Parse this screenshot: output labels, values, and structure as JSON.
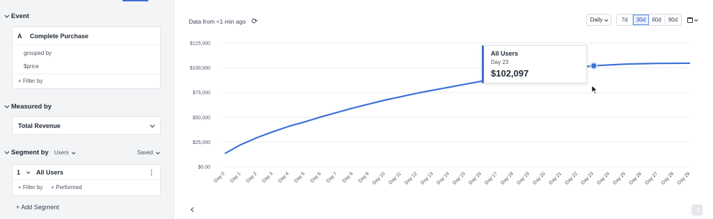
{
  "sidebar": {
    "event": {
      "section_label": "Event",
      "letter": "A",
      "name": "Complete Purchase",
      "grouped_by_label": "grouped by",
      "group_property": "$price",
      "filter_label": "+ Filter by"
    },
    "measured_by": {
      "section_label": "Measured by",
      "value": "Total Revenue"
    },
    "segment": {
      "section_label": "Segment by",
      "type_value": "Users",
      "saved_label": "Saved",
      "number": "1",
      "name": "All Users",
      "filter_label": "+ Filter by",
      "performed_label": "+ Performed",
      "add_label": "+ Add Segment"
    }
  },
  "toolbar": {
    "data_from": "Data from <1 min ago",
    "interval": "Daily",
    "ranges": [
      "7d",
      "30d",
      "60d",
      "90d"
    ],
    "active_range": "30d"
  },
  "tooltip": {
    "title": "All Users",
    "day": "Day 23",
    "value": "$102,097"
  },
  "icons": {
    "refresh": "refresh-icon",
    "calendar": "calendar-icon",
    "cursor": "mouse-pointer-icon"
  },
  "colors": {
    "accent": "#3b6fd8",
    "line": "#3b6fd8"
  },
  "chart_data": {
    "type": "line",
    "xlabel": "",
    "ylabel": "",
    "ylim": [
      0,
      125000
    ],
    "y_ticks": [
      "$0.00",
      "$25,000",
      "$50,000",
      "$75,000",
      "$100,000",
      "$125,000"
    ],
    "y_tick_values": [
      0,
      25000,
      50000,
      75000,
      100000,
      125000
    ],
    "categories": [
      "Day 0",
      "Day 1",
      "Day 2",
      "Day 3",
      "Day 4",
      "Day 5",
      "Day 6",
      "Day 7",
      "Day 8",
      "Day 9",
      "Day 10",
      "Day 11",
      "Day 12",
      "Day 13",
      "Day 14",
      "Day 15",
      "Day 16",
      "Day 17",
      "Day 18",
      "Day 19",
      "Day 20",
      "Day 21",
      "Day 22",
      "Day 23",
      "Day 24",
      "Day 25",
      "Day 26",
      "Day 27",
      "Day 28",
      "Day 29"
    ],
    "series": [
      {
        "name": "All Users",
        "values": [
          13500,
          22500,
          29500,
          35500,
          41000,
          45500,
          50500,
          55000,
          59500,
          63500,
          67500,
          71000,
          74500,
          77500,
          80500,
          83500,
          86500,
          89000,
          91500,
          94000,
          96500,
          98500,
          100500,
          102097,
          103000,
          103800,
          104200,
          104500,
          104600,
          104700
        ]
      }
    ],
    "highlighted_index": 23,
    "grid": true
  }
}
